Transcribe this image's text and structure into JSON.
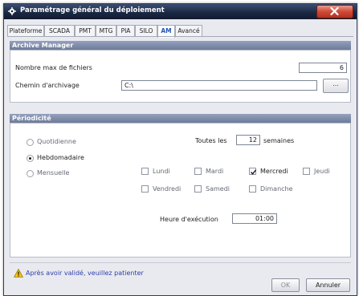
{
  "window": {
    "title": "Paramétrage général du déploiement",
    "app_icon": "gear-icon",
    "close_icon": "close-icon"
  },
  "tabs": [
    {
      "label": "Plateforme"
    },
    {
      "label": "SCADA"
    },
    {
      "label": "PMT"
    },
    {
      "label": "MTG"
    },
    {
      "label": "PIA"
    },
    {
      "label": "SILO"
    },
    {
      "label": "AM",
      "active": true
    },
    {
      "label": "Avancé"
    }
  ],
  "archive_manager": {
    "header": "Archive Manager",
    "max_files_label": "Nombre max de fichiers",
    "max_files_value": "6",
    "archive_path_label": "Chemin d'archivage",
    "archive_path_value": "C:\\",
    "browse_label": "..."
  },
  "periodicity": {
    "header": "Périodicité",
    "options": [
      {
        "label": "Quotidienne",
        "checked": false
      },
      {
        "label": "Hebdomadaire",
        "checked": true
      },
      {
        "label": "Mensuelle",
        "checked": false
      }
    ],
    "every_label": "Toutes les",
    "every_value": "12",
    "weeks_label": "semaines",
    "days": [
      {
        "label": "Lundi",
        "checked": false
      },
      {
        "label": "Mardi",
        "checked": false
      },
      {
        "label": "Mercredi",
        "checked": true
      },
      {
        "label": "Jeudi",
        "checked": false
      },
      {
        "label": "Vendredi",
        "checked": false
      },
      {
        "label": "Samedi",
        "checked": false
      },
      {
        "label": "Dimanche",
        "checked": false
      }
    ],
    "exec_time_label": "Heure d'exécution",
    "exec_time_value": "01:00"
  },
  "footer": {
    "warning_icon": "warning-icon",
    "warning_text": "Après avoir validé, veuillez patienter",
    "ok_label": "OK",
    "cancel_label": "Annuler"
  },
  "colors": {
    "titlebar": "#1c2944",
    "section_header": "#7c88a5",
    "close": "#cf4a36",
    "warning_text": "#2d3fa8"
  }
}
